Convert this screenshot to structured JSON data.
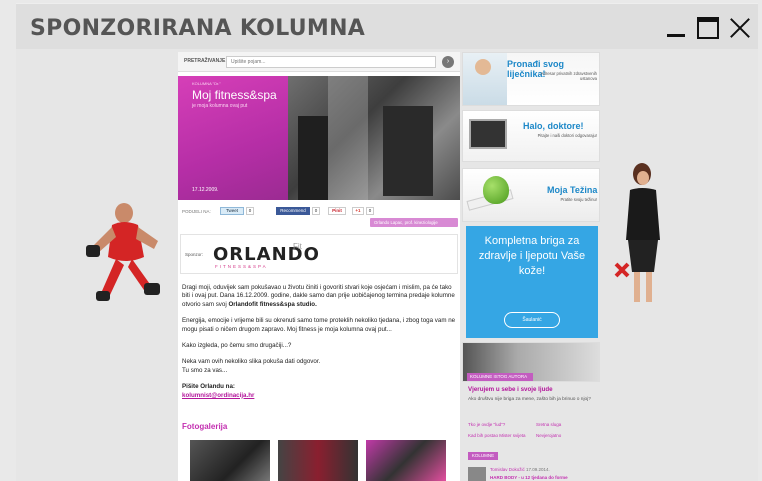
{
  "window": {
    "title": "SPONZORIRANA KOLUMNA"
  },
  "search": {
    "label": "PRETRAŽIVANJE",
    "placeholder": "Upišite pojam...",
    "go_icon": "arrow-right-icon"
  },
  "hero": {
    "kicker": "KOLUMNA \"Dr.\"",
    "title": "Moj fitness&spa",
    "subtitle": "je moja kolumna ovaj put",
    "date": "17.12.2009."
  },
  "share": {
    "label": "PODIJELI NA:",
    "tweet_label": "Tweet",
    "tweet_count": "0",
    "fb_label": "Recommend",
    "fb_count": "0",
    "pin_label": "Pinit",
    "gplus_label": "+1",
    "gplus_count": "0"
  },
  "author_tag": "Orlando Lapac, prof. kineziologije",
  "sponsor": {
    "label": "Sponzor:",
    "logo": "ORLANDO",
    "logo_fit": "Fit",
    "logo_sub": "FITNESS&SPA"
  },
  "article": {
    "p1": "Dragi moji, oduvijek sam pokušavao u životu činiti i govoriti stvari koje osjećam i mislim, pa će tako biti i ovaj put. Dana 16.12.2009. godine, dakle samo dan prije uobičajenog termina predaje kolumne otvorio sam svoj",
    "p1_bold": "Orlandofit fitness&spa studio.",
    "p2": "Energija, emocije i vrijeme bili su okrenuti samo tome proteklih nekoliko tjedana, i zbog toga vam ne mogu pisati o ničem drugom zapravo. Moj fitness je moja kolumna ovaj put...",
    "p3": "Kako izgleda, po čemu smo drugačiji...?",
    "p4_line1": "Neka vam ovih nekoliko slika pokuša dati odgovor.",
    "p4_line2": "Tu smo za vas...",
    "contact_label": "Pišite Orlandu na:",
    "contact_email": "kolumnist@ordinacija.hr"
  },
  "gallery": {
    "title": "Fotogalerija"
  },
  "sidebar": {
    "ad1": {
      "title": "Pronađi svog liječnika!",
      "subtitle": "Adresar privatnih zdravstvenih ustanova"
    },
    "ad2": {
      "title": "Halo, doktore!",
      "subtitle": "Pitajte i naši doktori odgovaraju!"
    },
    "ad3": {
      "title": "Moja Težina",
      "subtitle": "Pratite svoju težinu!"
    },
    "ad4": {
      "text": "Kompletna briga za zdravlje i ljepotu Vaše kože!",
      "logo": "Šaulanić"
    },
    "ad5": {
      "tag": "KOLUMNE ISTOG AUTORA"
    },
    "featured": {
      "title": "Vjerujem u sebe i svoje ljude",
      "text": "Ako društvu nije briga za mene, zašto bih ja brinuo o njoj?",
      "links": [
        "Tko je ovdje \"lud\"?",
        "Sretna sluga",
        "Kad bih postao Mister svijeta",
        "Nevjerojatno"
      ]
    },
    "kolumne": {
      "tag": "KOLUMNE",
      "meta_author": "Tomislav Dokožić",
      "meta_date": "17.09.2014.",
      "headline": "HARD BODY - u 12 tjedana do forme"
    }
  }
}
